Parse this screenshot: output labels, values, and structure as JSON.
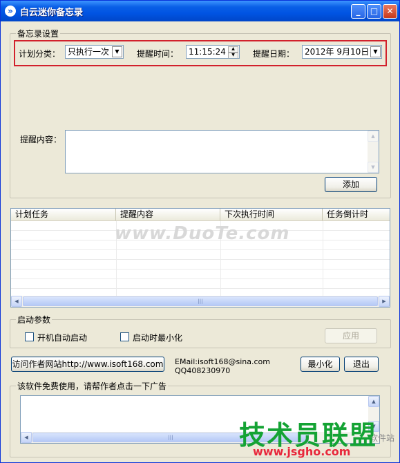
{
  "window": {
    "title": "白云迷你备忘录",
    "icon": "app-icon"
  },
  "settings": {
    "legend": "备忘录设置",
    "plan_category_label": "计划分类：",
    "plan_category_value": "只执行一次",
    "remind_time_label": "提醒时间：",
    "remind_time_value": "11:15:24",
    "remind_date_label": "提醒日期：",
    "remind_date_value": "2012年  9月10日",
    "content_label": "提醒内容：",
    "content_value": "",
    "add_button": "添加",
    "highlight_color": "#d2212c"
  },
  "task_list": {
    "columns": [
      "计划任务",
      "提醒内容",
      "下次执行时间",
      "任务倒计时"
    ],
    "rows": [],
    "watermark": "www.DuoTe.com"
  },
  "startup": {
    "legend": "启动参数",
    "auto_start_label": "开机自动启动",
    "auto_start_checked": false,
    "minimize_label": "启动时最小化",
    "minimize_checked": false,
    "apply_button": "应用"
  },
  "footer": {
    "website_button": "访问作者网站http://www.isoft168.com",
    "email": "EMail:isoft168@sina.com",
    "qq": "QQ408230970",
    "minimize_button": "最小化",
    "exit_button": "退出"
  },
  "ad": {
    "legend": "该软件免费使用，请帮作者点击一下广告"
  },
  "overlay": {
    "brand": "技术员联盟",
    "url": "www.jsgho.com",
    "side_text": "软件站"
  }
}
